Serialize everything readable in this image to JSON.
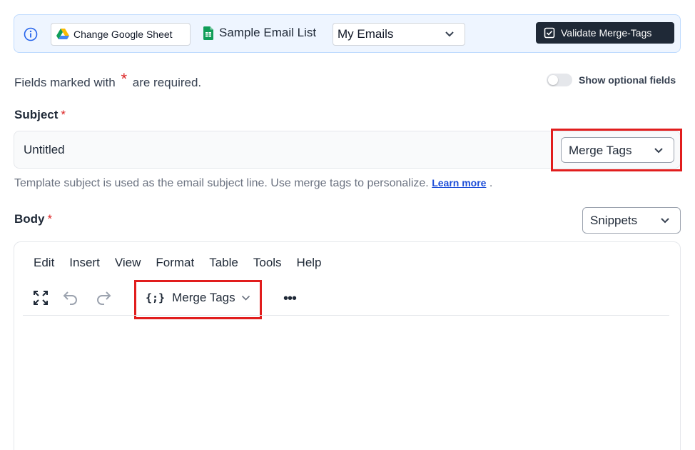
{
  "banner": {
    "change_sheet_label": "Change Google Sheet",
    "sheet_name": "Sample Email List",
    "tab_selected": "My Emails",
    "validate_label": "Validate Merge-Tags"
  },
  "required_note": {
    "prefix": "Fields marked with",
    "asterisk": "*",
    "suffix": "are required."
  },
  "optional_toggle": {
    "label": "Show optional fields",
    "on": false
  },
  "subject": {
    "label": "Subject",
    "required_mark": "*",
    "value": "Untitled",
    "merge_tags_label": "Merge Tags",
    "helper_text": "Template subject is used as the email subject line. Use merge tags to personalize.",
    "learn_more": "Learn more",
    "helper_end": "."
  },
  "body": {
    "label": "Body",
    "required_mark": "*",
    "snippets_label": "Snippets"
  },
  "editor": {
    "menu": [
      "Edit",
      "Insert",
      "View",
      "Format",
      "Table",
      "Tools",
      "Help"
    ],
    "merge_tags_code": "{;}",
    "merge_tags_label": "Merge Tags",
    "more": "•••"
  },
  "colors": {
    "highlight": "#e11d1d",
    "banner_bg": "#eef5ff",
    "primary_dark": "#1f2937",
    "required": "#dc2626",
    "link": "#1d4ed8"
  }
}
